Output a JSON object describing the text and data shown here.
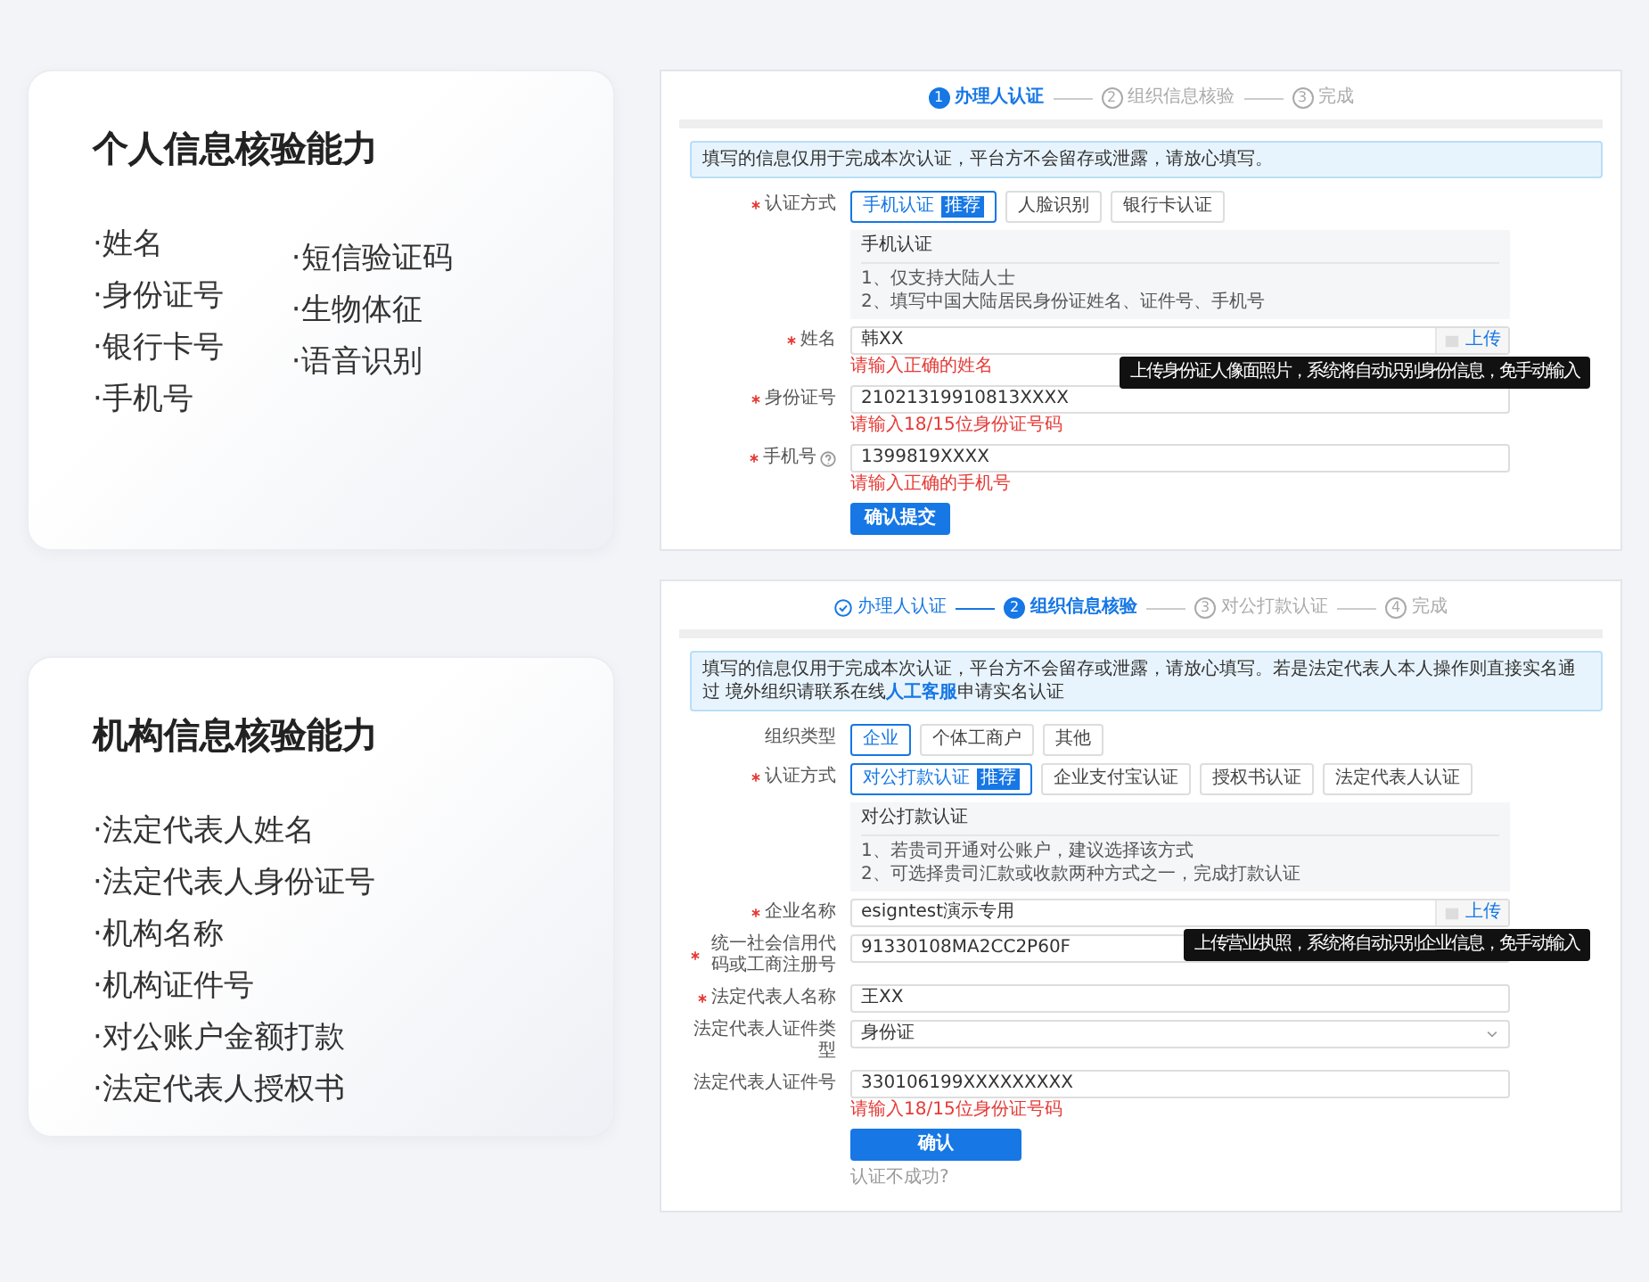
{
  "sections": [
    {
      "card": {
        "title": "个人信息核验能力",
        "columns": [
          [
            "·姓名",
            "·身份证号",
            "·银行卡号",
            "·手机号"
          ],
          [
            "·短信验证码",
            "·生物体征",
            "·语音识别"
          ]
        ]
      },
      "screen": {
        "steps": [
          {
            "number": "1",
            "label": "办理人认证",
            "selected": true,
            "done": false
          },
          {
            "number": "2",
            "label": "组织信息核验",
            "selected": false,
            "done": false
          },
          {
            "number": "3",
            "label": "完成",
            "selected": false,
            "done": false
          }
        ],
        "notice": {
          "text": "填写的信息仅用于完成本次认证，平台方不会留存或泄露，请放心填写。"
        },
        "rows": [
          {
            "kind": "choices",
            "label": "认证方式",
            "required": true,
            "options": [
              {
                "label": "手机认证",
                "badge": "推荐",
                "selected": true
              },
              {
                "label": "人脸识别",
                "selected": false
              },
              {
                "label": "银行卡认证",
                "selected": false
              }
            ]
          },
          {
            "kind": "info",
            "title": "手机认证",
            "lines": [
              "1、仅支持大陆人士",
              "2、填写中国大陆居民身份证姓名、证件号、手机号"
            ]
          },
          {
            "kind": "field",
            "label": "姓名",
            "required": true,
            "value": "韩XX",
            "error": "请输入正确的姓名",
            "upload": "上传",
            "tooltip": "上传身份证人像面照片，系统将自动识别身份信息，免手动输入"
          },
          {
            "kind": "field",
            "label": "身份证号",
            "required": true,
            "value": "21021319910813XXXX",
            "error": "请输入18/15位身份证号码"
          },
          {
            "kind": "field",
            "label": "手机号",
            "required": true,
            "help": true,
            "value": "1399819XXXX",
            "error": "请输入正确的手机号"
          },
          {
            "kind": "button",
            "label": "确认提交",
            "wide": false
          }
        ]
      }
    },
    {
      "card": {
        "title": "机构信息核验能力",
        "columns": [
          [
            "·法定代表人姓名",
            "·法定代表人身份证号",
            "·机构名称",
            "·机构证件号",
            "·对公账户金额打款",
            "·法定代表人授权书"
          ]
        ]
      },
      "screen": {
        "steps": [
          {
            "label": "办理人认证",
            "selected": false,
            "done": true
          },
          {
            "number": "2",
            "label": "组织信息核验",
            "selected": true,
            "done": false
          },
          {
            "number": "3",
            "label": "对公打款认证",
            "selected": false,
            "done": false
          },
          {
            "number": "4",
            "label": "完成",
            "selected": false,
            "done": false
          }
        ],
        "notice": {
          "text": "填写的信息仅用于完成本次认证，平台方不会留存或泄露，请放心填写。若是法定代表人本人操作则直接实名通过 境外组织请联系在线",
          "link": "人工客服",
          "after": "申请实名认证"
        },
        "rows": [
          {
            "kind": "choices",
            "label": "组织类型",
            "required": false,
            "options": [
              {
                "label": "企业",
                "selected": true
              },
              {
                "label": "个体工商户",
                "selected": false
              },
              {
                "label": "其他",
                "selected": false
              }
            ]
          },
          {
            "kind": "choices",
            "label": "认证方式",
            "required": true,
            "options": [
              {
                "label": "对公打款认证",
                "badge": "推荐",
                "selected": true
              },
              {
                "label": "企业支付宝认证",
                "selected": false
              },
              {
                "label": "授权书认证",
                "selected": false
              },
              {
                "label": "法定代表人认证",
                "selected": false
              }
            ]
          },
          {
            "kind": "info",
            "title": "对公打款认证",
            "lines": [
              "1、若贵司开通对公账户，建议选择该方式",
              "2、可选择贵司汇款或收款两种方式之一，完成打款认证"
            ]
          },
          {
            "kind": "field",
            "label": "企业名称",
            "required": true,
            "value": "esigntest演示专用",
            "upload": "上传",
            "tooltip": "上传营业执照，系统将自动识别企业信息，免手动输入"
          },
          {
            "kind": "field",
            "label": "统一社会信用代码或工商注册号",
            "required": true,
            "value": "91330108MA2CC2P60F"
          },
          {
            "kind": "field",
            "label": "法定代表人名称",
            "required": true,
            "value": "王XX"
          },
          {
            "kind": "select",
            "label": "法定代表人证件类型",
            "required": false,
            "value": "身份证"
          },
          {
            "kind": "field",
            "label": "法定代表人证件号",
            "required": false,
            "value": "330106199XXXXXXXXX",
            "error": "请输入18/15位身份证号码"
          },
          {
            "kind": "button",
            "label": "确认",
            "wide": true
          },
          {
            "kind": "link",
            "label": "认证不成功?"
          }
        ]
      }
    }
  ]
}
